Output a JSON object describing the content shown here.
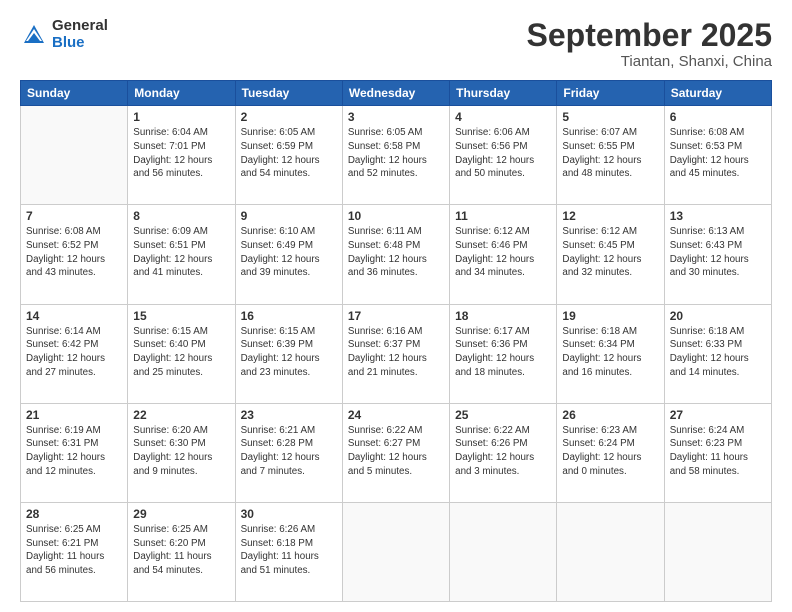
{
  "logo": {
    "general": "General",
    "blue": "Blue"
  },
  "header": {
    "month": "September 2025",
    "location": "Tiantan, Shanxi, China"
  },
  "weekdays": [
    "Sunday",
    "Monday",
    "Tuesday",
    "Wednesday",
    "Thursday",
    "Friday",
    "Saturday"
  ],
  "weeks": [
    [
      {
        "day": "",
        "info": ""
      },
      {
        "day": "1",
        "info": "Sunrise: 6:04 AM\nSunset: 7:01 PM\nDaylight: 12 hours\nand 56 minutes."
      },
      {
        "day": "2",
        "info": "Sunrise: 6:05 AM\nSunset: 6:59 PM\nDaylight: 12 hours\nand 54 minutes."
      },
      {
        "day": "3",
        "info": "Sunrise: 6:05 AM\nSunset: 6:58 PM\nDaylight: 12 hours\nand 52 minutes."
      },
      {
        "day": "4",
        "info": "Sunrise: 6:06 AM\nSunset: 6:56 PM\nDaylight: 12 hours\nand 50 minutes."
      },
      {
        "day": "5",
        "info": "Sunrise: 6:07 AM\nSunset: 6:55 PM\nDaylight: 12 hours\nand 48 minutes."
      },
      {
        "day": "6",
        "info": "Sunrise: 6:08 AM\nSunset: 6:53 PM\nDaylight: 12 hours\nand 45 minutes."
      }
    ],
    [
      {
        "day": "7",
        "info": "Sunrise: 6:08 AM\nSunset: 6:52 PM\nDaylight: 12 hours\nand 43 minutes."
      },
      {
        "day": "8",
        "info": "Sunrise: 6:09 AM\nSunset: 6:51 PM\nDaylight: 12 hours\nand 41 minutes."
      },
      {
        "day": "9",
        "info": "Sunrise: 6:10 AM\nSunset: 6:49 PM\nDaylight: 12 hours\nand 39 minutes."
      },
      {
        "day": "10",
        "info": "Sunrise: 6:11 AM\nSunset: 6:48 PM\nDaylight: 12 hours\nand 36 minutes."
      },
      {
        "day": "11",
        "info": "Sunrise: 6:12 AM\nSunset: 6:46 PM\nDaylight: 12 hours\nand 34 minutes."
      },
      {
        "day": "12",
        "info": "Sunrise: 6:12 AM\nSunset: 6:45 PM\nDaylight: 12 hours\nand 32 minutes."
      },
      {
        "day": "13",
        "info": "Sunrise: 6:13 AM\nSunset: 6:43 PM\nDaylight: 12 hours\nand 30 minutes."
      }
    ],
    [
      {
        "day": "14",
        "info": "Sunrise: 6:14 AM\nSunset: 6:42 PM\nDaylight: 12 hours\nand 27 minutes."
      },
      {
        "day": "15",
        "info": "Sunrise: 6:15 AM\nSunset: 6:40 PM\nDaylight: 12 hours\nand 25 minutes."
      },
      {
        "day": "16",
        "info": "Sunrise: 6:15 AM\nSunset: 6:39 PM\nDaylight: 12 hours\nand 23 minutes."
      },
      {
        "day": "17",
        "info": "Sunrise: 6:16 AM\nSunset: 6:37 PM\nDaylight: 12 hours\nand 21 minutes."
      },
      {
        "day": "18",
        "info": "Sunrise: 6:17 AM\nSunset: 6:36 PM\nDaylight: 12 hours\nand 18 minutes."
      },
      {
        "day": "19",
        "info": "Sunrise: 6:18 AM\nSunset: 6:34 PM\nDaylight: 12 hours\nand 16 minutes."
      },
      {
        "day": "20",
        "info": "Sunrise: 6:18 AM\nSunset: 6:33 PM\nDaylight: 12 hours\nand 14 minutes."
      }
    ],
    [
      {
        "day": "21",
        "info": "Sunrise: 6:19 AM\nSunset: 6:31 PM\nDaylight: 12 hours\nand 12 minutes."
      },
      {
        "day": "22",
        "info": "Sunrise: 6:20 AM\nSunset: 6:30 PM\nDaylight: 12 hours\nand 9 minutes."
      },
      {
        "day": "23",
        "info": "Sunrise: 6:21 AM\nSunset: 6:28 PM\nDaylight: 12 hours\nand 7 minutes."
      },
      {
        "day": "24",
        "info": "Sunrise: 6:22 AM\nSunset: 6:27 PM\nDaylight: 12 hours\nand 5 minutes."
      },
      {
        "day": "25",
        "info": "Sunrise: 6:22 AM\nSunset: 6:26 PM\nDaylight: 12 hours\nand 3 minutes."
      },
      {
        "day": "26",
        "info": "Sunrise: 6:23 AM\nSunset: 6:24 PM\nDaylight: 12 hours\nand 0 minutes."
      },
      {
        "day": "27",
        "info": "Sunrise: 6:24 AM\nSunset: 6:23 PM\nDaylight: 11 hours\nand 58 minutes."
      }
    ],
    [
      {
        "day": "28",
        "info": "Sunrise: 6:25 AM\nSunset: 6:21 PM\nDaylight: 11 hours\nand 56 minutes."
      },
      {
        "day": "29",
        "info": "Sunrise: 6:25 AM\nSunset: 6:20 PM\nDaylight: 11 hours\nand 54 minutes."
      },
      {
        "day": "30",
        "info": "Sunrise: 6:26 AM\nSunset: 6:18 PM\nDaylight: 11 hours\nand 51 minutes."
      },
      {
        "day": "",
        "info": ""
      },
      {
        "day": "",
        "info": ""
      },
      {
        "day": "",
        "info": ""
      },
      {
        "day": "",
        "info": ""
      }
    ]
  ]
}
